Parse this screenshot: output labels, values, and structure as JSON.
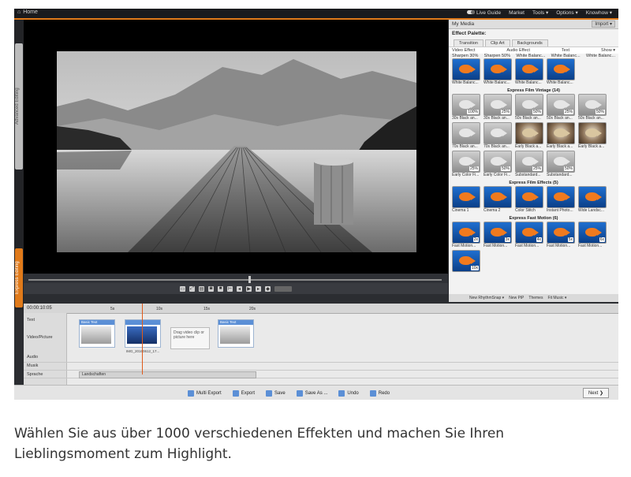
{
  "titlebar": {
    "home": "Home",
    "live_guide": "Live Guide",
    "market": "Market",
    "tools": "Tools ▾",
    "options": "Options ▾",
    "knowhow": "Knowhow ▾"
  },
  "left_tabs": {
    "advanced": "Advanced Editing",
    "express": "Express Editing"
  },
  "media_panel": {
    "title": "My Media",
    "import": "Import ▾",
    "effect_palette": "Effect Palette:",
    "tabs": [
      "Transition",
      "Clip Art",
      "Backgrounds"
    ],
    "subtabs": [
      "Video Effect",
      "Audio Effect",
      "Text"
    ],
    "show": "Show ▾",
    "top_labels": [
      "Sharpen 30%",
      "Sharpen 50%",
      "White Balanc...",
      "White Balanc...",
      "White Balanc..."
    ],
    "white_balance_tiles": [
      "White Balanc...",
      "White Balanc...",
      "White Balanc...",
      "White Balanc..."
    ],
    "vintage_title": "Express Film Vintage (14)",
    "vintage_tiles": [
      {
        "cap": "30s Black an...",
        "badge": "100%",
        "style": "gray"
      },
      {
        "cap": "30s Black an...",
        "badge": "25%",
        "style": "gray"
      },
      {
        "cap": "50s Black an...",
        "badge": "50%",
        "style": "gray"
      },
      {
        "cap": "50s Black an...",
        "badge": "25%",
        "style": "gray"
      },
      {
        "cap": "50s Black an...",
        "badge": "50%",
        "style": "gray"
      },
      {
        "cap": "70s Black an...",
        "badge": "",
        "style": "gray"
      },
      {
        "cap": "70s Black an...",
        "badge": "",
        "style": "gray"
      },
      {
        "cap": "Early Black a...",
        "badge": "",
        "style": "sepia"
      },
      {
        "cap": "Early Black a...",
        "badge": "",
        "style": "sepia"
      },
      {
        "cap": "Early Black a...",
        "badge": "",
        "style": "sepia"
      },
      {
        "cap": "Early Color Fi...",
        "badge": "25%",
        "style": "gray"
      },
      {
        "cap": "Early Color Fi...",
        "badge": "50%",
        "style": "gray"
      },
      {
        "cap": "Substandard...",
        "badge": "25%",
        "style": "gray"
      },
      {
        "cap": "Substandard...",
        "badge": "50%",
        "style": "gray"
      }
    ],
    "film_effects_title": "Express Film Effects (5)",
    "film_tiles": [
      "Cinema 1",
      "Cinema 2",
      "Color Stitch",
      "Instant Photo...",
      "Wide Landsc..."
    ],
    "fast_motion_title": "Express Fast Motion (6)",
    "fast_tiles": [
      {
        "cap": "Fast Motion...",
        "badge": "2x"
      },
      {
        "cap": "Fast Motion...",
        "badge": "3x"
      },
      {
        "cap": "Fast Motion...",
        "badge": "4x"
      },
      {
        "cap": "Fast Motion...",
        "badge": "5x"
      },
      {
        "cap": "Fast Motion...",
        "badge": "6x"
      },
      {
        "cap": "",
        "badge": "10x"
      }
    ],
    "bottom": [
      "New RhythmSnap ▾",
      "New PiP",
      "Themes",
      "Fit Music ▾"
    ]
  },
  "timeline": {
    "timecode": "00:00:10:05",
    "rows": [
      "Text",
      "Video/Picture",
      "Audio",
      "Musik",
      "Sprache"
    ],
    "ruler_marks": [
      "5s",
      "10s",
      "15s",
      "20s"
    ],
    "text_clips": [
      "Basic Text",
      "",
      "Basic Text"
    ],
    "clip_caption": "IMG_20160612_17...",
    "drop_hint": "Drag video clip or picture here",
    "music_clip": "Landschaften"
  },
  "bottombar": {
    "multi_export": "Multi Export",
    "export": "Export",
    "save": "Save",
    "save_as": "Save As ...",
    "undo": "Undo",
    "redo": "Redo",
    "next": "Next"
  },
  "caption": "Wählen Sie aus über 1000 verschiedenen Effekten und machen Sie Ihren Lieblingsmoment zum Highlight.",
  "colors": {
    "accent": "#e07a1a",
    "clip_blue": "#5b8fd6"
  }
}
